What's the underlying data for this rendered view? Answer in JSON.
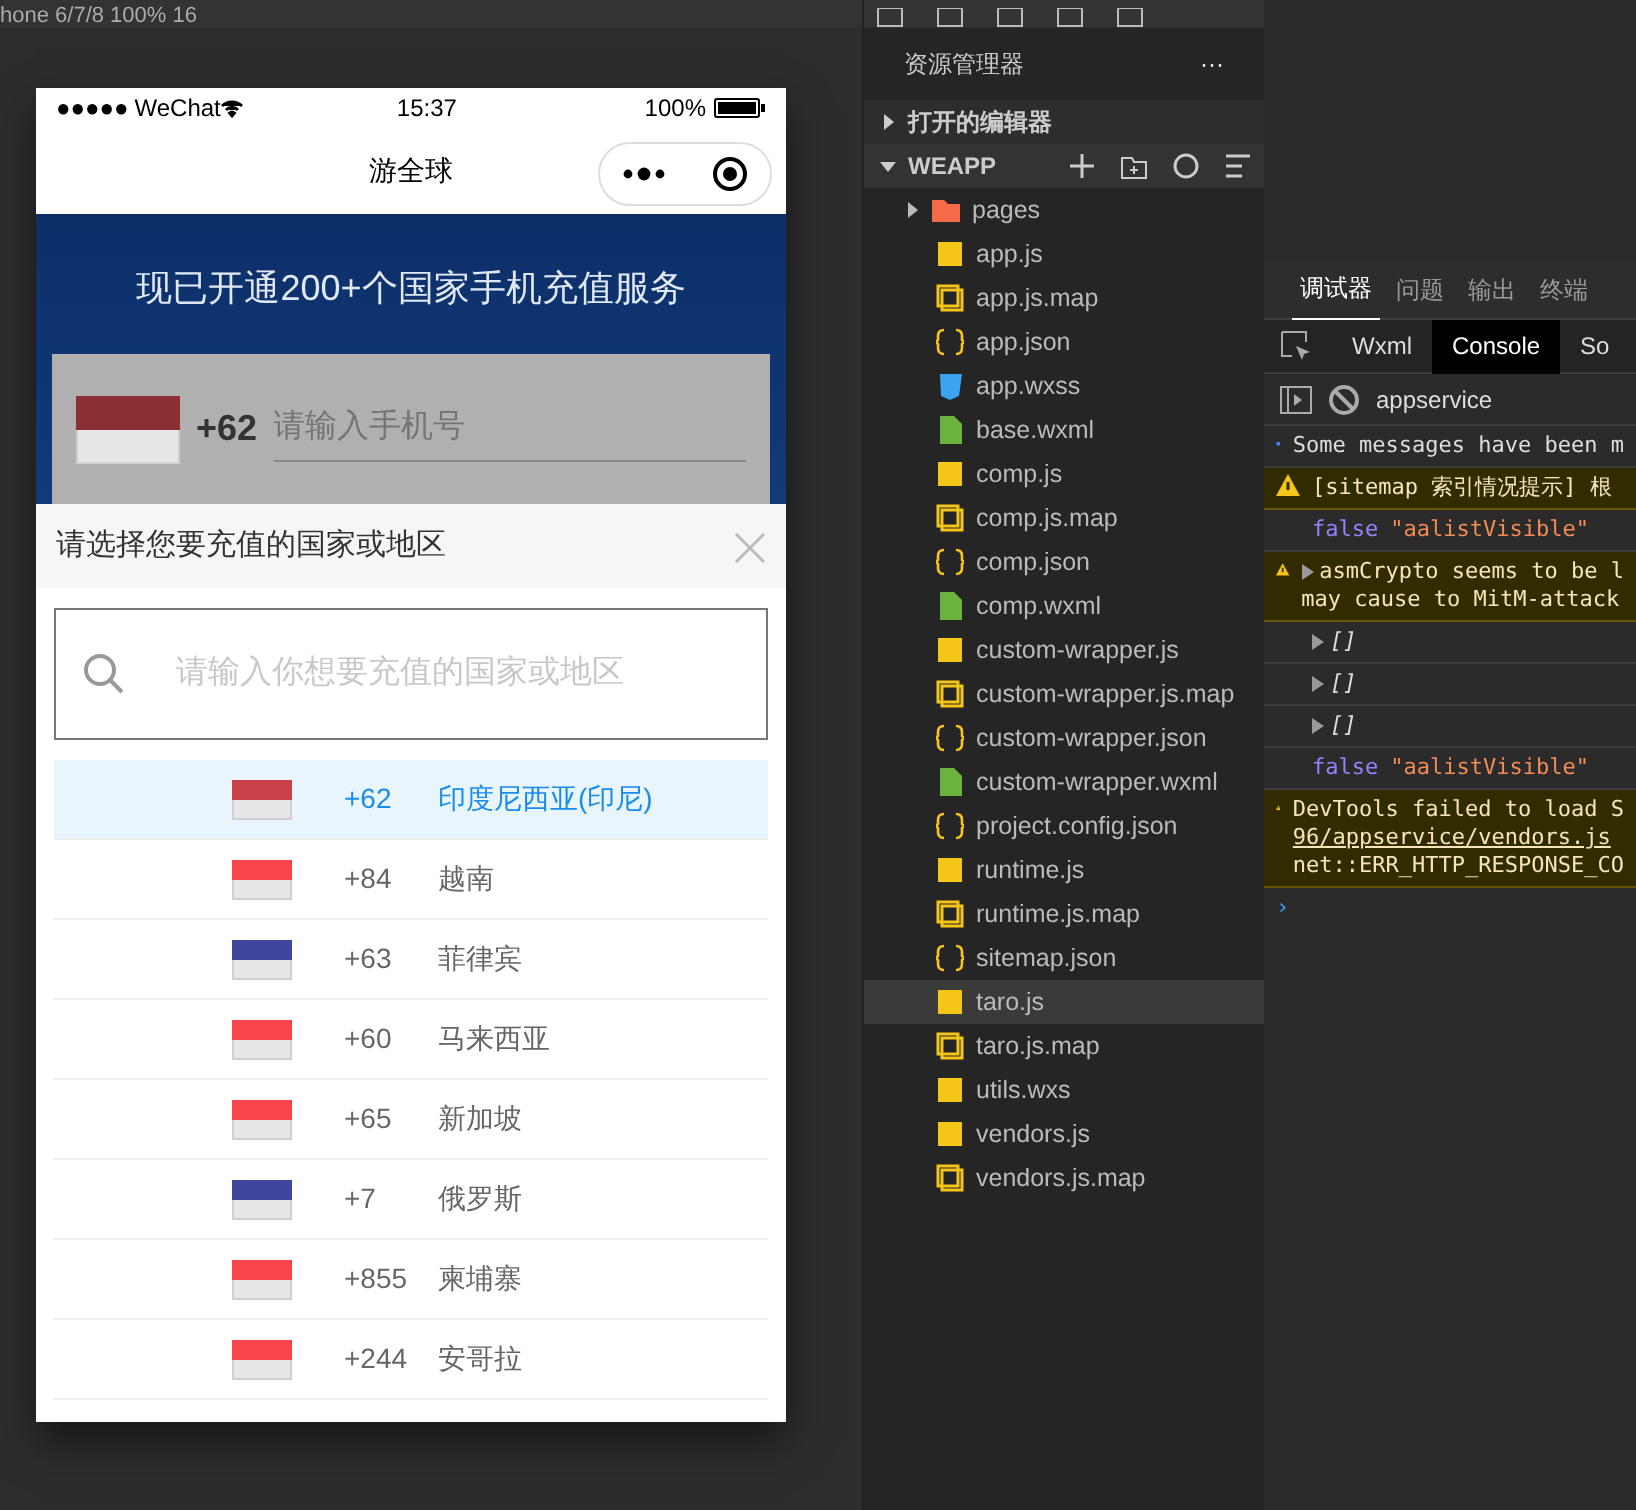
{
  "toolbar": {
    "device": "hone 6/7/8 100% 16"
  },
  "phone": {
    "status": {
      "signal": "●●●●●",
      "carrier": "WeChat",
      "time": "15:37",
      "battery": "100%"
    },
    "nav": {
      "title": "游全球"
    },
    "banner": {
      "headline": "现已开通200+个国家手机充值服务",
      "code": "+62",
      "placeholder": "请输入手机号",
      "color": "#8c2f35"
    },
    "sheet": {
      "title": "请选择您要充值的国家或地区",
      "search_placeholder": "请输入你想要充值的国家或地区",
      "countries": [
        {
          "code": "+62",
          "name": "印度尼西亚(印尼)",
          "selected": true,
          "color": "#c9424a"
        },
        {
          "code": "+84",
          "name": "越南",
          "selected": false,
          "color": "#f9444a"
        },
        {
          "code": "+63",
          "name": "菲律宾",
          "selected": false,
          "color": "#3d479d"
        },
        {
          "code": "+60",
          "name": "马来西亚",
          "selected": false,
          "color": "#f9444b"
        },
        {
          "code": "+65",
          "name": "新加坡",
          "selected": false,
          "color": "#f9444c"
        },
        {
          "code": "+7",
          "name": "俄罗斯",
          "selected": false,
          "color": "#3d479e"
        },
        {
          "code": "+855",
          "name": "柬埔寨",
          "selected": false,
          "color": "#f9454a"
        },
        {
          "code": "+244",
          "name": "安哥拉",
          "selected": false,
          "color": "#f8444a"
        }
      ]
    }
  },
  "explorer": {
    "title": "资源管理器",
    "more": "···",
    "sections": [
      {
        "label": "打开的编辑器",
        "expanded": false
      },
      {
        "label": "WEAPP",
        "expanded": true
      }
    ],
    "files": [
      {
        "name": "pages",
        "kind": "folder",
        "selected": false
      },
      {
        "name": "app.js",
        "kind": "js",
        "selected": false
      },
      {
        "name": "app.js.map",
        "kind": "map",
        "selected": false
      },
      {
        "name": "app.json",
        "kind": "json",
        "selected": false
      },
      {
        "name": "app.wxss",
        "kind": "css",
        "selected": false
      },
      {
        "name": "base.wxml",
        "kind": "wxml",
        "selected": false
      },
      {
        "name": "comp.js",
        "kind": "js",
        "selected": false
      },
      {
        "name": "comp.js.map",
        "kind": "map",
        "selected": false
      },
      {
        "name": "comp.json",
        "kind": "json",
        "selected": false
      },
      {
        "name": "comp.wxml",
        "kind": "wxml",
        "selected": false
      },
      {
        "name": "custom-wrapper.js",
        "kind": "js",
        "selected": false
      },
      {
        "name": "custom-wrapper.js.map",
        "kind": "map",
        "selected": false
      },
      {
        "name": "custom-wrapper.json",
        "kind": "json",
        "selected": false
      },
      {
        "name": "custom-wrapper.wxml",
        "kind": "wxml",
        "selected": false
      },
      {
        "name": "project.config.json",
        "kind": "json",
        "selected": false
      },
      {
        "name": "runtime.js",
        "kind": "js",
        "selected": false
      },
      {
        "name": "runtime.js.map",
        "kind": "map",
        "selected": false
      },
      {
        "name": "sitemap.json",
        "kind": "json",
        "selected": false
      },
      {
        "name": "taro.js",
        "kind": "js",
        "selected": true
      },
      {
        "name": "taro.js.map",
        "kind": "map",
        "selected": false
      },
      {
        "name": "utils.wxs",
        "kind": "js",
        "selected": false
      },
      {
        "name": "vendors.js",
        "kind": "js",
        "selected": false
      },
      {
        "name": "vendors.js.map",
        "kind": "map",
        "selected": false
      }
    ]
  },
  "devtools": {
    "tabs": [
      {
        "label": "调试器",
        "selected": true
      },
      {
        "label": "问题",
        "selected": false
      },
      {
        "label": "输出",
        "selected": false
      },
      {
        "label": "终端",
        "selected": false
      }
    ],
    "subtabs": [
      {
        "label": "Wxml",
        "selected": false
      },
      {
        "label": "Console",
        "selected": true
      },
      {
        "label": "So",
        "selected": false
      }
    ],
    "context": "appservice",
    "messages": [
      {
        "kind": "info",
        "lines": [
          "Some messages have been m"
        ]
      },
      {
        "kind": "warn",
        "lines": [
          "[sitemap 索引情况提示] 根"
        ]
      },
      {
        "kind": "value",
        "keyword": "false",
        "text": "\"aalistVisible\""
      },
      {
        "kind": "warn",
        "expandable": true,
        "lines": [
          "asmCrypto seems to be l",
          "may cause to MitM-attack"
        ]
      },
      {
        "kind": "array",
        "text": "[]"
      },
      {
        "kind": "array",
        "text": "[]"
      },
      {
        "kind": "array",
        "text": "[]"
      },
      {
        "kind": "value",
        "keyword": "false",
        "text": "\"aalistVisible\""
      },
      {
        "kind": "warn",
        "lines": [
          "DevTools failed to load S",
          "96/appservice/vendors.js",
          "net::ERR_HTTP_RESPONSE_CO"
        ]
      }
    ],
    "prompt": "›"
  }
}
